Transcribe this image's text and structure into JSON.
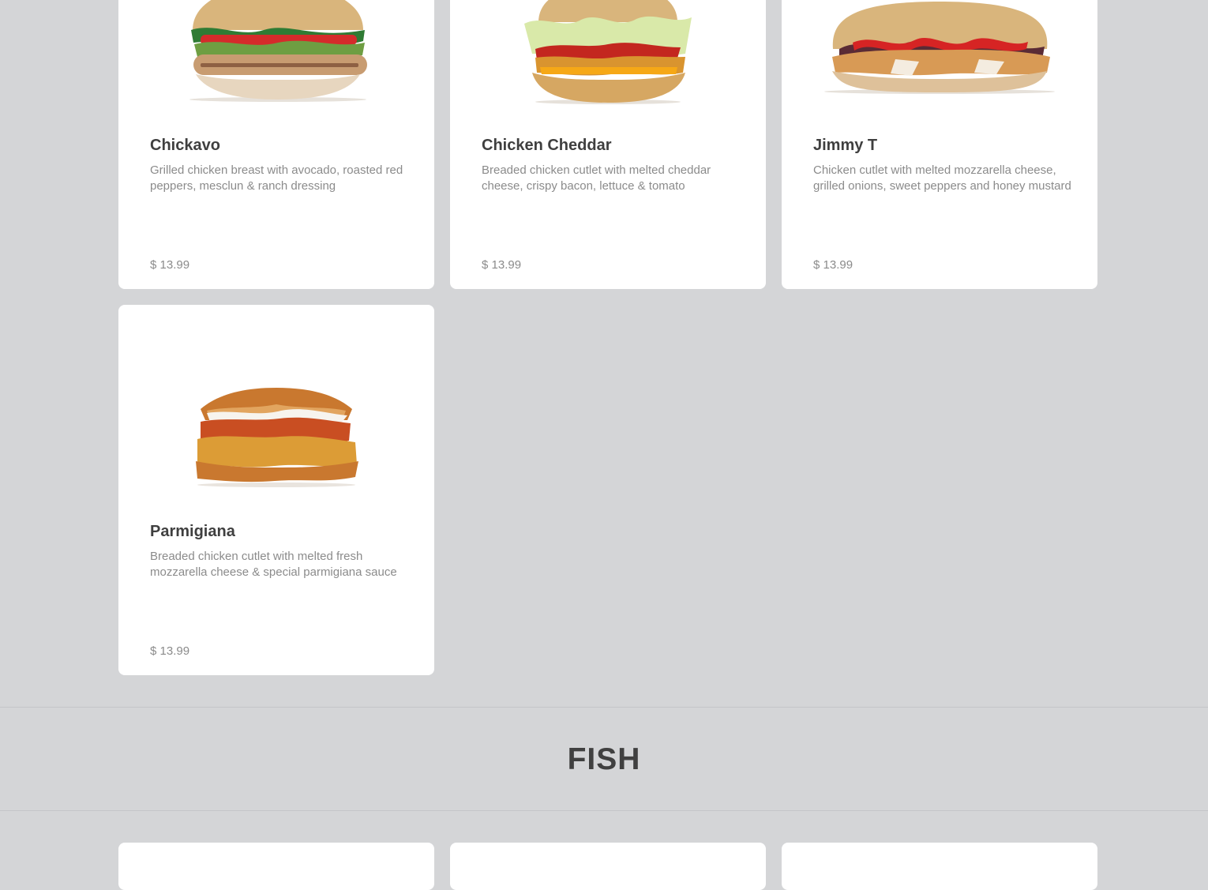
{
  "sections": {
    "chicken_items": [
      {
        "name": "Chickavo",
        "description": "Grilled chicken breast with avocado, roasted red peppers, mesclun & ranch dressing",
        "price": "$ 13.99",
        "image_alt": "Chickavo sandwich"
      },
      {
        "name": "Chicken Cheddar",
        "description": "Breaded chicken cutlet with melted cheddar cheese, crispy bacon, lettuce & tomato",
        "price": "$ 13.99",
        "image_alt": "Chicken Cheddar sandwich"
      },
      {
        "name": "Jimmy T",
        "description": "Chicken cutlet with melted mozzarella cheese, grilled onions, sweet peppers and honey mustard",
        "price": "$ 13.99",
        "image_alt": "Jimmy T sandwich"
      },
      {
        "name": "Parmigiana",
        "description": "Breaded chicken cutlet with melted fresh mozzarella cheese & special parmigiana sauce",
        "price": "$ 13.99",
        "image_alt": "Parmigiana sandwich"
      }
    ],
    "fish": {
      "title": "FISH"
    }
  },
  "colors": {
    "page_background": "#d4d5d7",
    "card_background": "#ffffff",
    "title_text": "#3f3f3f",
    "body_text": "#8b8b8b",
    "divider": "#c4c5c8"
  },
  "icons": {
    "card_image_type": "sandwich-photo"
  }
}
